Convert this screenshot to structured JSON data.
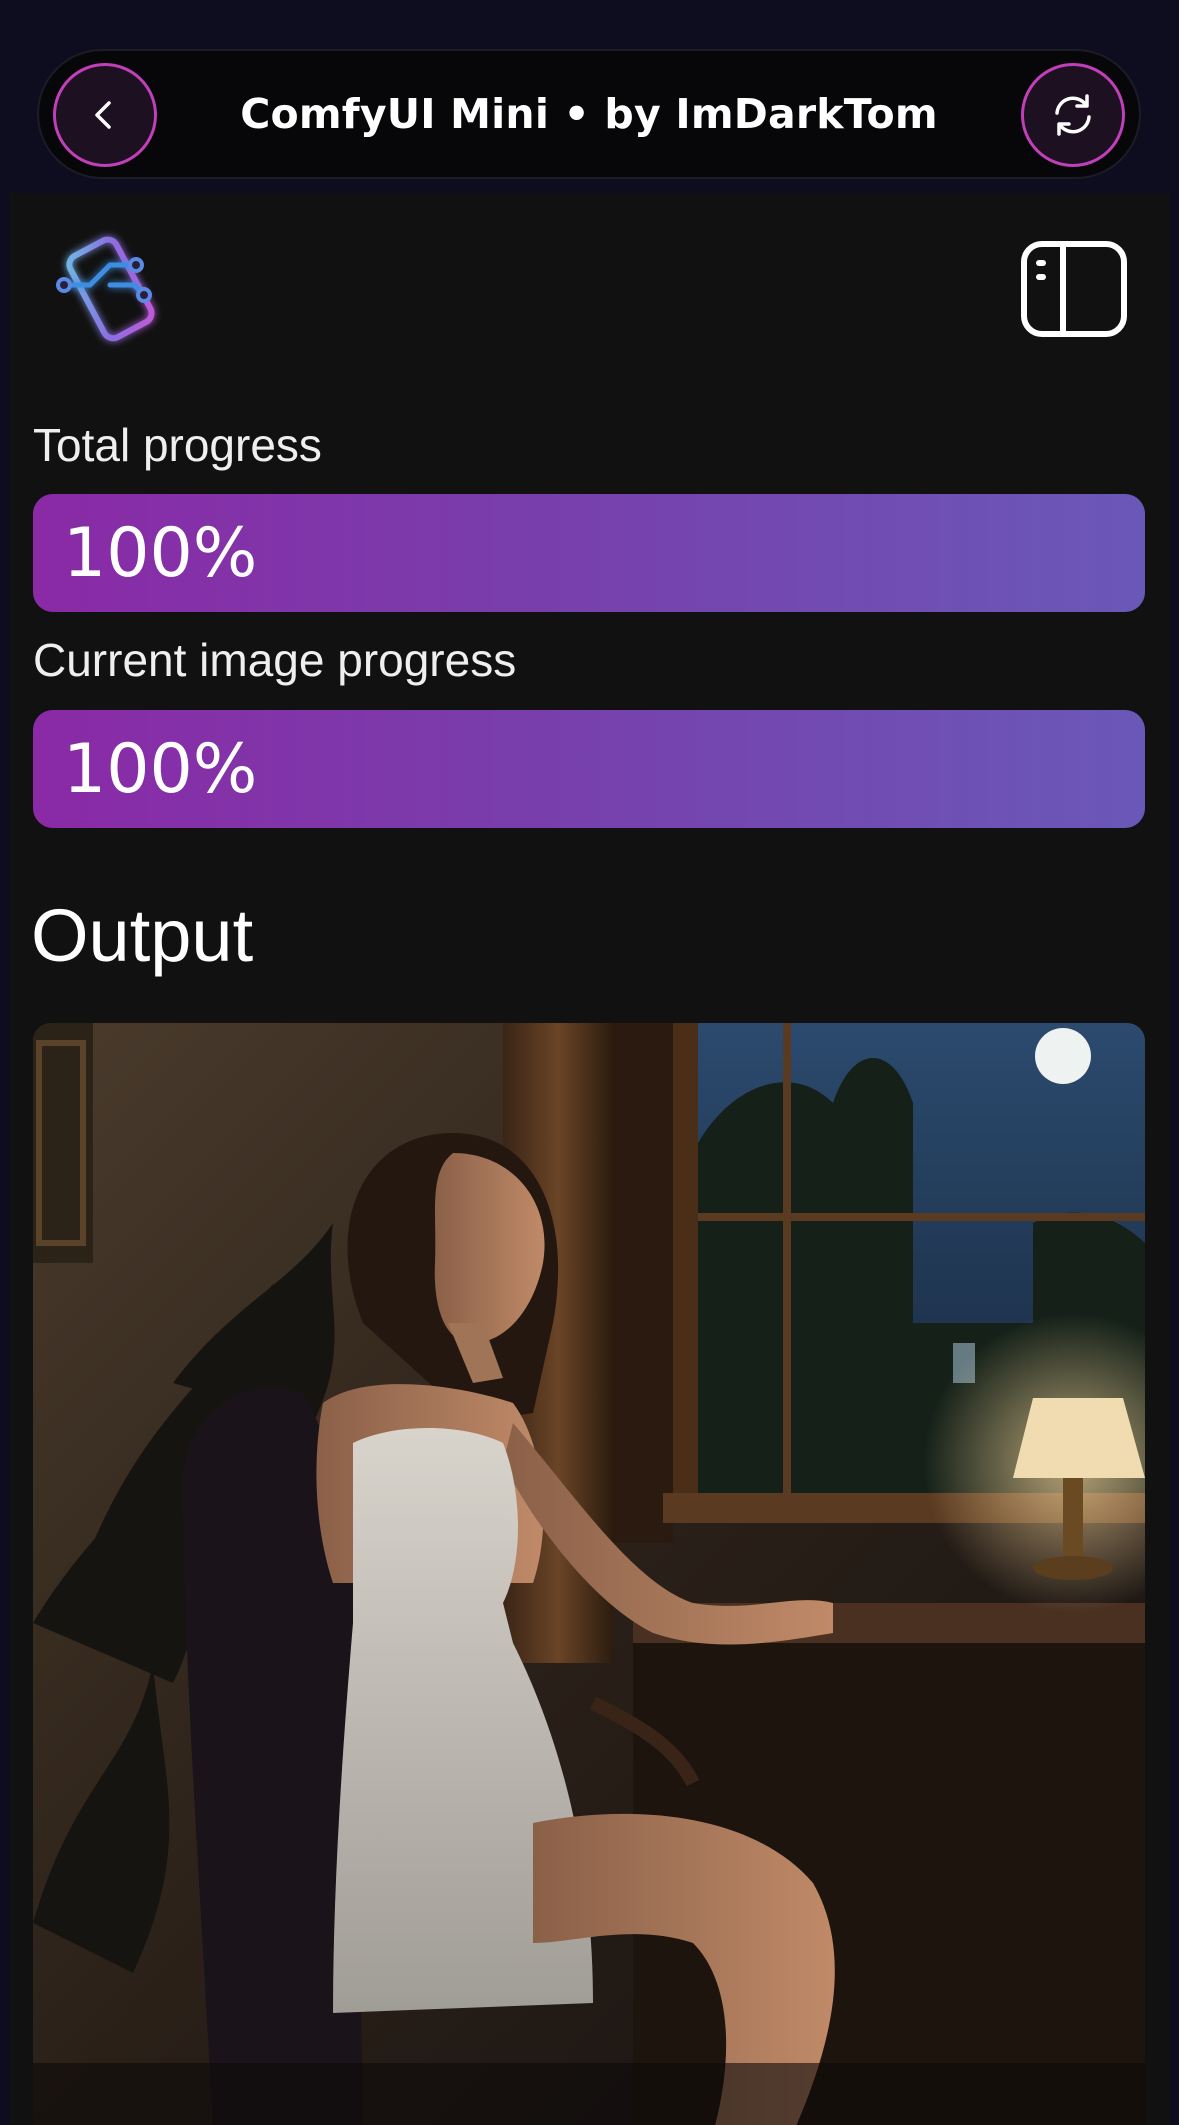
{
  "header": {
    "title": "ComfyUI Mini • by ImDarkTom",
    "back_icon": "chevron-left-icon",
    "reload_icon": "refresh-icon"
  },
  "app": {
    "logo_icon": "phone-workflow-logo-icon",
    "sidebar_toggle_icon": "sidebar-toggle-icon"
  },
  "progress": {
    "total_label": "Total progress",
    "total_text": "100%",
    "total_value": 1.0,
    "current_label": "Current image progress",
    "current_text": "100%",
    "current_value": 1.0
  },
  "output": {
    "heading": "Output",
    "image_subject": "generated-image"
  },
  "colors": {
    "accent_border": "#c13fb9",
    "progress_start": "#8a2aa6",
    "progress_end": "#6a58b8",
    "panel_bg": "#111111",
    "header_bg": "#0d0d1f"
  }
}
